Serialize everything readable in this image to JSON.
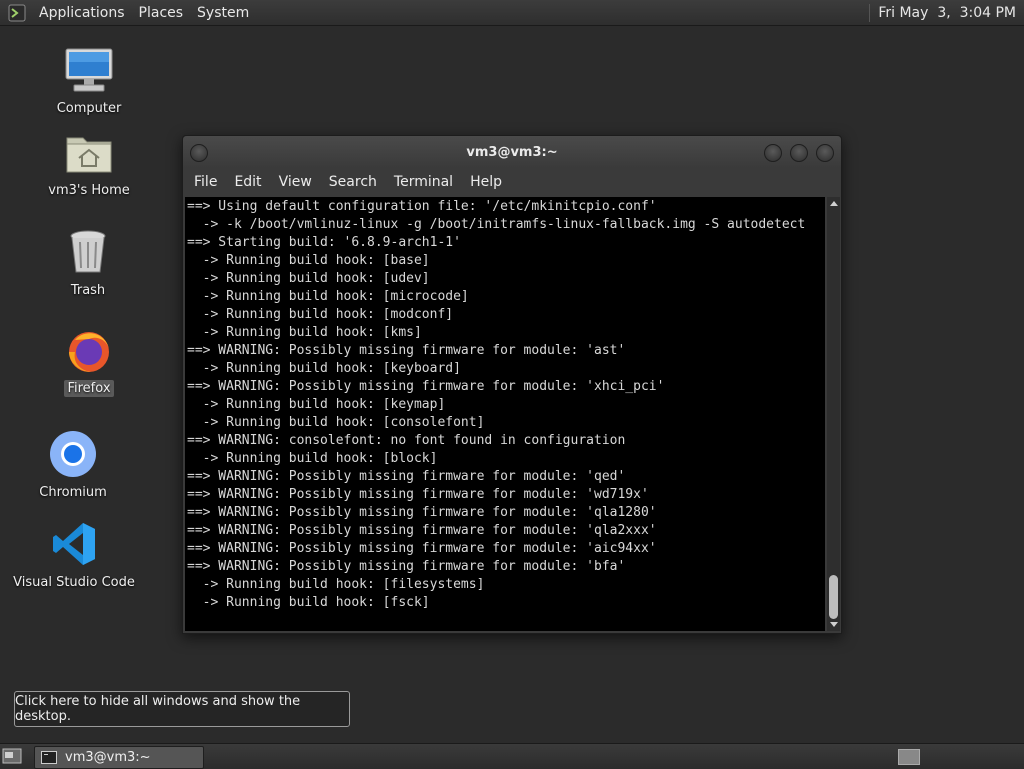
{
  "top_panel": {
    "menus": [
      "Applications",
      "Places",
      "System"
    ],
    "clock": "Fri May  3,  3:04 PM"
  },
  "desktop": {
    "icons": [
      {
        "label": "Computer",
        "icon": "computer-icon"
      },
      {
        "label": "vm3's Home",
        "icon": "home-folder-icon"
      },
      {
        "label": "Trash",
        "icon": "trash-icon"
      },
      {
        "label": "Firefox",
        "icon": "firefox-icon"
      },
      {
        "label": "Chromium",
        "icon": "chromium-icon"
      },
      {
        "label": "Visual Studio Code",
        "icon": "vscode-icon"
      }
    ]
  },
  "terminal": {
    "title": "vm3@vm3:~",
    "menu": [
      "File",
      "Edit",
      "View",
      "Search",
      "Terminal",
      "Help"
    ],
    "lines": [
      "==> Using default configuration file: '/etc/mkinitcpio.conf'",
      "  -> -k /boot/vmlinuz-linux -g /boot/initramfs-linux-fallback.img -S autodetect",
      "==> Starting build: '6.8.9-arch1-1'",
      "  -> Running build hook: [base]",
      "  -> Running build hook: [udev]",
      "  -> Running build hook: [microcode]",
      "  -> Running build hook: [modconf]",
      "  -> Running build hook: [kms]",
      "==> WARNING: Possibly missing firmware for module: 'ast'",
      "  -> Running build hook: [keyboard]",
      "==> WARNING: Possibly missing firmware for module: 'xhci_pci'",
      "  -> Running build hook: [keymap]",
      "  -> Running build hook: [consolefont]",
      "==> WARNING: consolefont: no font found in configuration",
      "  -> Running build hook: [block]",
      "==> WARNING: Possibly missing firmware for module: 'qed'",
      "==> WARNING: Possibly missing firmware for module: 'wd719x'",
      "==> WARNING: Possibly missing firmware for module: 'qla1280'",
      "==> WARNING: Possibly missing firmware for module: 'qla2xxx'",
      "==> WARNING: Possibly missing firmware for module: 'aic94xx'",
      "==> WARNING: Possibly missing firmware for module: 'bfa'",
      "  -> Running build hook: [filesystems]",
      "  -> Running build hook: [fsck]"
    ]
  },
  "tooltip": "Click here to hide all windows and show the desktop.",
  "taskbar": {
    "tasks": [
      {
        "label": "vm3@vm3:~"
      }
    ]
  }
}
